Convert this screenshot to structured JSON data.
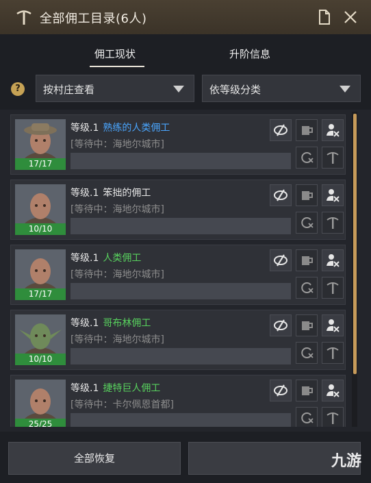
{
  "window": {
    "title": "全部佣工目录(6人)"
  },
  "tabs": [
    {
      "label": "佣工现状"
    },
    {
      "label": "升阶信息"
    }
  ],
  "filters": {
    "help": "?",
    "village_select": "按村庄查看",
    "sort_select": "依等级分类"
  },
  "workers": [
    {
      "level": "等级.1",
      "name": "熟练的人类佣工",
      "name_color": "#4aa6ff",
      "status": "[等待中：海地尔城市]",
      "stamina": "17/17"
    },
    {
      "level": "等级.1",
      "name": "笨拙的佣工",
      "name_color": "#e8e8e8",
      "status": "[等待中：海地尔城市]",
      "stamina": "10/10"
    },
    {
      "level": "等级.1",
      "name": "人类佣工",
      "name_color": "#58d25e",
      "status": "[等待中：海地尔城市]",
      "stamina": "17/17"
    },
    {
      "level": "等级.1",
      "name": "哥布林佣工",
      "name_color": "#58d25e",
      "status": "[等待中：海地尔城市]",
      "stamina": "10/10"
    },
    {
      "level": "等级.1",
      "name": "捷特巨人佣工",
      "name_color": "#58d25e",
      "status": "[等待中：卡尔佩恩首都]",
      "stamina": "25/25"
    }
  ],
  "footer": {
    "recover_all": "全部恢复",
    "second_button": ""
  },
  "watermark": "九游",
  "colors": {
    "accent": "#c79b5a",
    "stamina": "#2f8d3c"
  }
}
